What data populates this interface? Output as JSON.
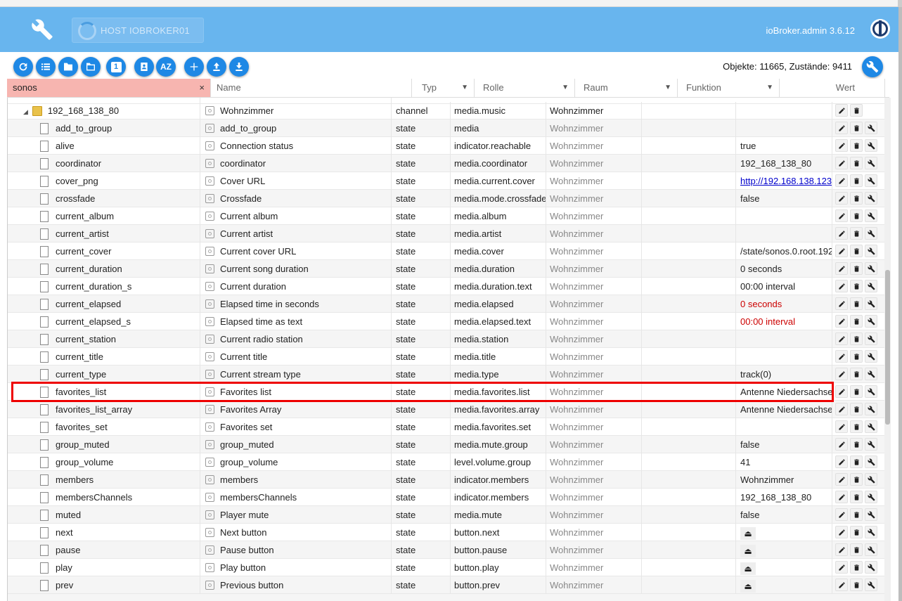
{
  "header": {
    "host_label": "HOST IOBROKER01",
    "version": "ioBroker.admin 3.6.12"
  },
  "toolbar": {
    "buttons": [
      "refresh-icon",
      "list-icon",
      "folder-icon",
      "folder-open-icon",
      "numeric-icon",
      "contact-icon",
      "sort-az-icon",
      "add-icon",
      "upload-icon",
      "download-icon"
    ],
    "az_label": "AZ",
    "numeric_label": "1",
    "counts": "Objekte: 11665, Zustände: 9411"
  },
  "filters": {
    "search_value": "sonos",
    "clear": "×",
    "name_placeholder": "Name",
    "typ": "Typ",
    "rolle": "Rolle",
    "raum": "Raum",
    "funktion": "Funktion",
    "wert": "Wert",
    "dropdown_arrow": "▼"
  },
  "table": {
    "folder_row": {
      "id": "192_168_138_80",
      "name": "Wohnzimmer",
      "typ": "channel",
      "rolle": "media.music",
      "raum": "Wohnzimmer",
      "wert": ""
    },
    "rows": [
      {
        "id": "add_to_group",
        "name": "add_to_group",
        "typ": "state",
        "rolle": "media",
        "raum": "Wohnzimmer",
        "wert": ""
      },
      {
        "id": "alive",
        "name": "Connection status",
        "typ": "state",
        "rolle": "indicator.reachable",
        "raum": "Wohnzimmer",
        "wert": "true"
      },
      {
        "id": "coordinator",
        "name": "coordinator",
        "typ": "state",
        "rolle": "media.coordinator",
        "raum": "Wohnzimmer",
        "wert": "192_168_138_80"
      },
      {
        "id": "cover_png",
        "name": "Cover URL",
        "typ": "state",
        "rolle": "media.current.cover",
        "raum": "Wohnzimmer",
        "wert": "http://192.168.138.123"
      },
      {
        "id": "crossfade",
        "name": "Crossfade",
        "typ": "state",
        "rolle": "media.mode.crossfade",
        "raum": "Wohnzimmer",
        "wert": "false"
      },
      {
        "id": "current_album",
        "name": "Current album",
        "typ": "state",
        "rolle": "media.album",
        "raum": "Wohnzimmer",
        "wert": ""
      },
      {
        "id": "current_artist",
        "name": "Current artist",
        "typ": "state",
        "rolle": "media.artist",
        "raum": "Wohnzimmer",
        "wert": ""
      },
      {
        "id": "current_cover",
        "name": "Current cover URL",
        "typ": "state",
        "rolle": "media.cover",
        "raum": "Wohnzimmer",
        "wert": "/state/sonos.0.root.192"
      },
      {
        "id": "current_duration",
        "name": "Current song duration",
        "typ": "state",
        "rolle": "media.duration",
        "raum": "Wohnzimmer",
        "wert": "0 seconds"
      },
      {
        "id": "current_duration_s",
        "name": "Current duration",
        "typ": "state",
        "rolle": "media.duration.text",
        "raum": "Wohnzimmer",
        "wert": "00:00 interval"
      },
      {
        "id": "current_elapsed",
        "name": "Elapsed time in seconds",
        "typ": "state",
        "rolle": "media.elapsed",
        "raum": "Wohnzimmer",
        "wert": "0 seconds"
      },
      {
        "id": "current_elapsed_s",
        "name": "Elapsed time as text",
        "typ": "state",
        "rolle": "media.elapsed.text",
        "raum": "Wohnzimmer",
        "wert": "00:00 interval"
      },
      {
        "id": "current_station",
        "name": "Current radio station",
        "typ": "state",
        "rolle": "media.station",
        "raum": "Wohnzimmer",
        "wert": ""
      },
      {
        "id": "current_title",
        "name": "Current title",
        "typ": "state",
        "rolle": "media.title",
        "raum": "Wohnzimmer",
        "wert": ""
      },
      {
        "id": "current_type",
        "name": "Current stream type",
        "typ": "state",
        "rolle": "media.type",
        "raum": "Wohnzimmer",
        "wert": "track(0)"
      },
      {
        "id": "favorites_list",
        "name": "Favorites list",
        "typ": "state",
        "rolle": "media.favorites.list",
        "raum": "Wohnzimmer",
        "wert": "Antenne Niedersachsen"
      },
      {
        "id": "favorites_list_array",
        "name": "Favorites Array",
        "typ": "state",
        "rolle": "media.favorites.array",
        "raum": "Wohnzimmer",
        "wert": "Antenne Niedersachsen"
      },
      {
        "id": "favorites_set",
        "name": "Favorites set",
        "typ": "state",
        "rolle": "media.favorites.set",
        "raum": "Wohnzimmer",
        "wert": ""
      },
      {
        "id": "group_muted",
        "name": "group_muted",
        "typ": "state",
        "rolle": "media.mute.group",
        "raum": "Wohnzimmer",
        "wert": "false"
      },
      {
        "id": "group_volume",
        "name": "group_volume",
        "typ": "state",
        "rolle": "level.volume.group",
        "raum": "Wohnzimmer",
        "wert": "41"
      },
      {
        "id": "members",
        "name": "members",
        "typ": "state",
        "rolle": "indicator.members",
        "raum": "Wohnzimmer",
        "wert": "Wohnzimmer"
      },
      {
        "id": "membersChannels",
        "name": "membersChannels",
        "typ": "state",
        "rolle": "indicator.members",
        "raum": "Wohnzimmer",
        "wert": "192_168_138_80"
      },
      {
        "id": "muted",
        "name": "Player mute",
        "typ": "state",
        "rolle": "media.mute",
        "raum": "Wohnzimmer",
        "wert": "false"
      },
      {
        "id": "next",
        "name": "Next button",
        "typ": "state",
        "rolle": "button.next",
        "raum": "Wohnzimmer",
        "wert": "⏏"
      },
      {
        "id": "pause",
        "name": "Pause button",
        "typ": "state",
        "rolle": "button.pause",
        "raum": "Wohnzimmer",
        "wert": "⏏"
      },
      {
        "id": "play",
        "name": "Play button",
        "typ": "state",
        "rolle": "button.play",
        "raum": "Wohnzimmer",
        "wert": "⏏"
      },
      {
        "id": "prev",
        "name": "Previous button",
        "typ": "state",
        "rolle": "button.prev",
        "raum": "Wohnzimmer",
        "wert": "⏏"
      }
    ],
    "red_value_rows": [
      "current_elapsed",
      "current_elapsed_s"
    ],
    "link_value_rows": [
      "cover_png"
    ],
    "button_value_rows": [
      "next",
      "pause",
      "play",
      "prev"
    ],
    "highlighted_row": "favorites_list"
  },
  "colors": {
    "header_bg": "#68b5ee",
    "button_blue": "#1e88e5",
    "search_bg": "#f7b5b0",
    "highlight": "#e00000",
    "red_value": "#cc0000"
  }
}
